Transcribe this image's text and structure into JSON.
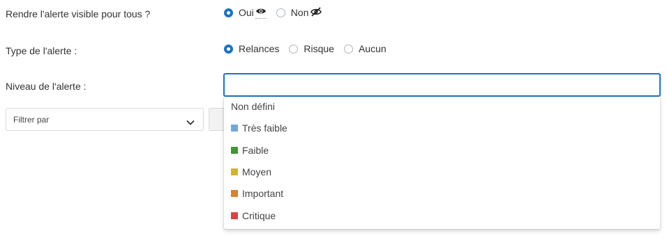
{
  "visibility": {
    "label": "Rendre l'alerte visible pour tous ?",
    "options": [
      {
        "label": "Oui",
        "checked": true,
        "icon": "eye-icon"
      },
      {
        "label": "Non",
        "checked": false,
        "icon": "eye-slash-icon"
      }
    ]
  },
  "type": {
    "label": "Type de l'alerte :",
    "options": [
      {
        "label": "Relances",
        "checked": true
      },
      {
        "label": "Risque",
        "checked": false
      },
      {
        "label": "Aucun",
        "checked": false
      }
    ]
  },
  "level": {
    "label": "Niveau de l'alerte :",
    "value": "",
    "options": [
      {
        "label": "Non défini",
        "color": null
      },
      {
        "label": "Très faible",
        "color": "#6fa8dc"
      },
      {
        "label": "Faible",
        "color": "#3c9a2e"
      },
      {
        "label": "Moyen",
        "color": "#d4b42a"
      },
      {
        "label": "Important",
        "color": "#d9822b"
      },
      {
        "label": "Critique",
        "color": "#d94343"
      }
    ]
  },
  "filter": {
    "placeholder": "Filtrer par"
  },
  "colors": {
    "accent": "#1a73c8"
  }
}
